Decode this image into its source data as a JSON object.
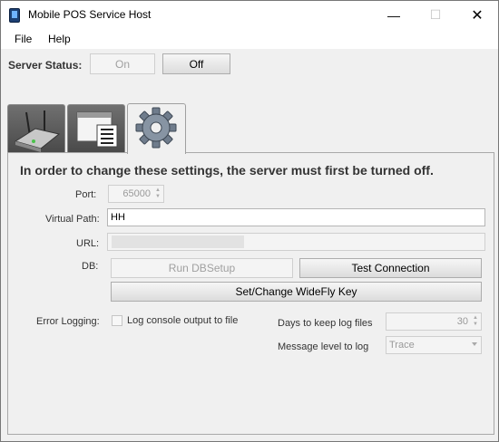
{
  "window": {
    "title": "Mobile POS Service Host",
    "min_icon": "minimize-icon",
    "max_icon": "maximize-icon",
    "close_icon": "close-icon",
    "min_glyph": "—",
    "max_glyph": "☐",
    "close_glyph": "✕"
  },
  "menu": {
    "file": "File",
    "help": "Help"
  },
  "server": {
    "status_label": "Server Status:",
    "on_label": "On",
    "off_label": "Off"
  },
  "tabs": [
    {
      "icon": "router-icon"
    },
    {
      "icon": "window-list-icon"
    },
    {
      "icon": "gear-icon",
      "selected": true
    }
  ],
  "settings": {
    "notice": "In order to change these settings, the server must first be turned off.",
    "port_label": "Port:",
    "port_value": "65000",
    "virtual_path_label": "Virtual Path:",
    "virtual_path_value": "HH",
    "url_label": "URL:",
    "url_value": "",
    "db_label": "DB:",
    "run_dbsetup_label": "Run DBSetup",
    "test_connection_label": "Test Connection",
    "widefly_key_label": "Set/Change WideFly Key",
    "error_logging_label": "Error Logging:",
    "log_console_label": "Log console output to file",
    "log_console_checked": false,
    "days_keep_label": "Days to keep log files",
    "days_keep_value": "30",
    "message_level_label": "Message level to log",
    "message_level_value": "Trace"
  },
  "colors": {
    "title_bg": "#ffffff",
    "window_bg": "#f0f0f0",
    "disabled_text": "#a0a0a0",
    "tab_dark": "#4a4a4a"
  }
}
